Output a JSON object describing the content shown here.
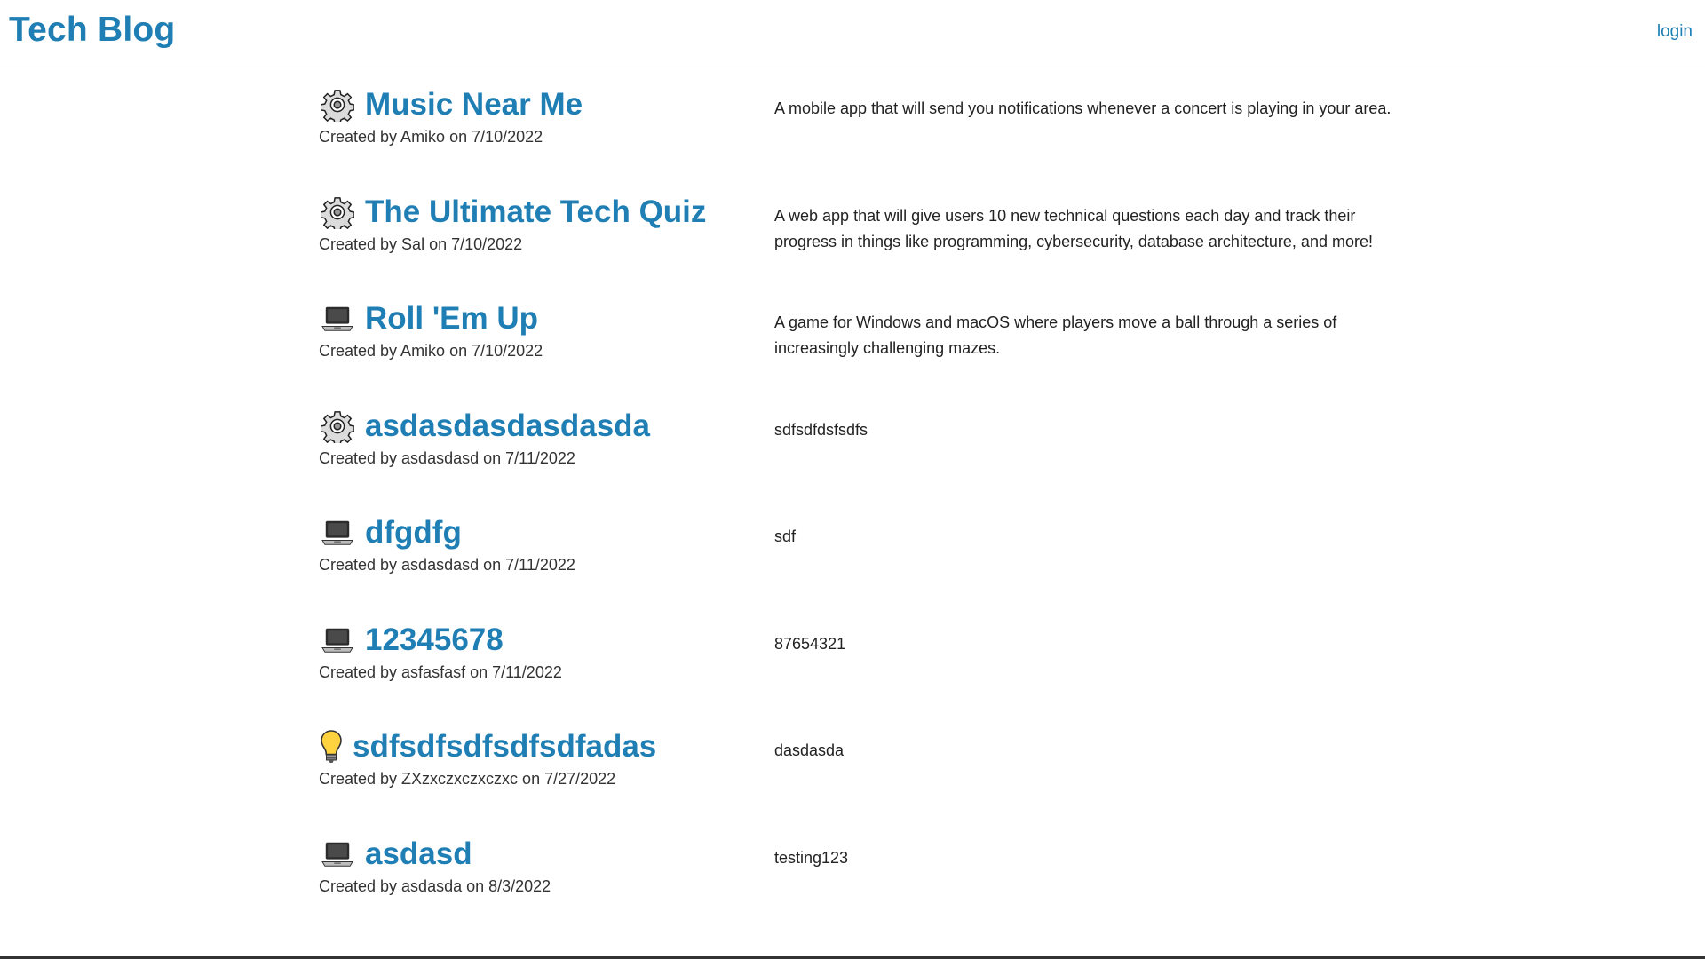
{
  "header": {
    "title": "Tech Blog",
    "login_label": "login"
  },
  "posts": [
    {
      "icon": "gear-icon",
      "title": "Music Near Me",
      "byline": "Created by Amiko on 7/10/2022",
      "description": "A mobile app that will send you notifications whenever a concert is playing in your area."
    },
    {
      "icon": "gear-icon",
      "title": "The Ultimate Tech Quiz",
      "byline": "Created by Sal on 7/10/2022",
      "description": "A web app that will give users 10 new technical questions each day and track their progress in things like programming, cybersecurity, database architecture, and more!"
    },
    {
      "icon": "laptop-icon",
      "title": "Roll 'Em Up",
      "byline": "Created by Amiko on 7/10/2022",
      "description": "A game for Windows and macOS where players move a ball through a series of increasingly challenging mazes."
    },
    {
      "icon": "gear-icon",
      "title": "asdasdasdasdasda",
      "byline": "Created by asdasdasd on 7/11/2022",
      "description": "sdfsdfdsfsdfs"
    },
    {
      "icon": "laptop-icon",
      "title": "dfgdfg",
      "byline": "Created by asdasdasd on 7/11/2022",
      "description": "sdf"
    },
    {
      "icon": "laptop-icon",
      "title": "12345678",
      "byline": "Created by asfasfasf on 7/11/2022",
      "description": "87654321"
    },
    {
      "icon": "lightbulb-icon",
      "title": "sdfsdfsdfsdfsdfadas",
      "byline": "Created by ZXzxczxczxczxc on 7/27/2022",
      "description": "dasdasda"
    },
    {
      "icon": "laptop-icon",
      "title": "asdasd",
      "byline": "Created by asdasda on 8/3/2022",
      "description": "testing123"
    }
  ]
}
